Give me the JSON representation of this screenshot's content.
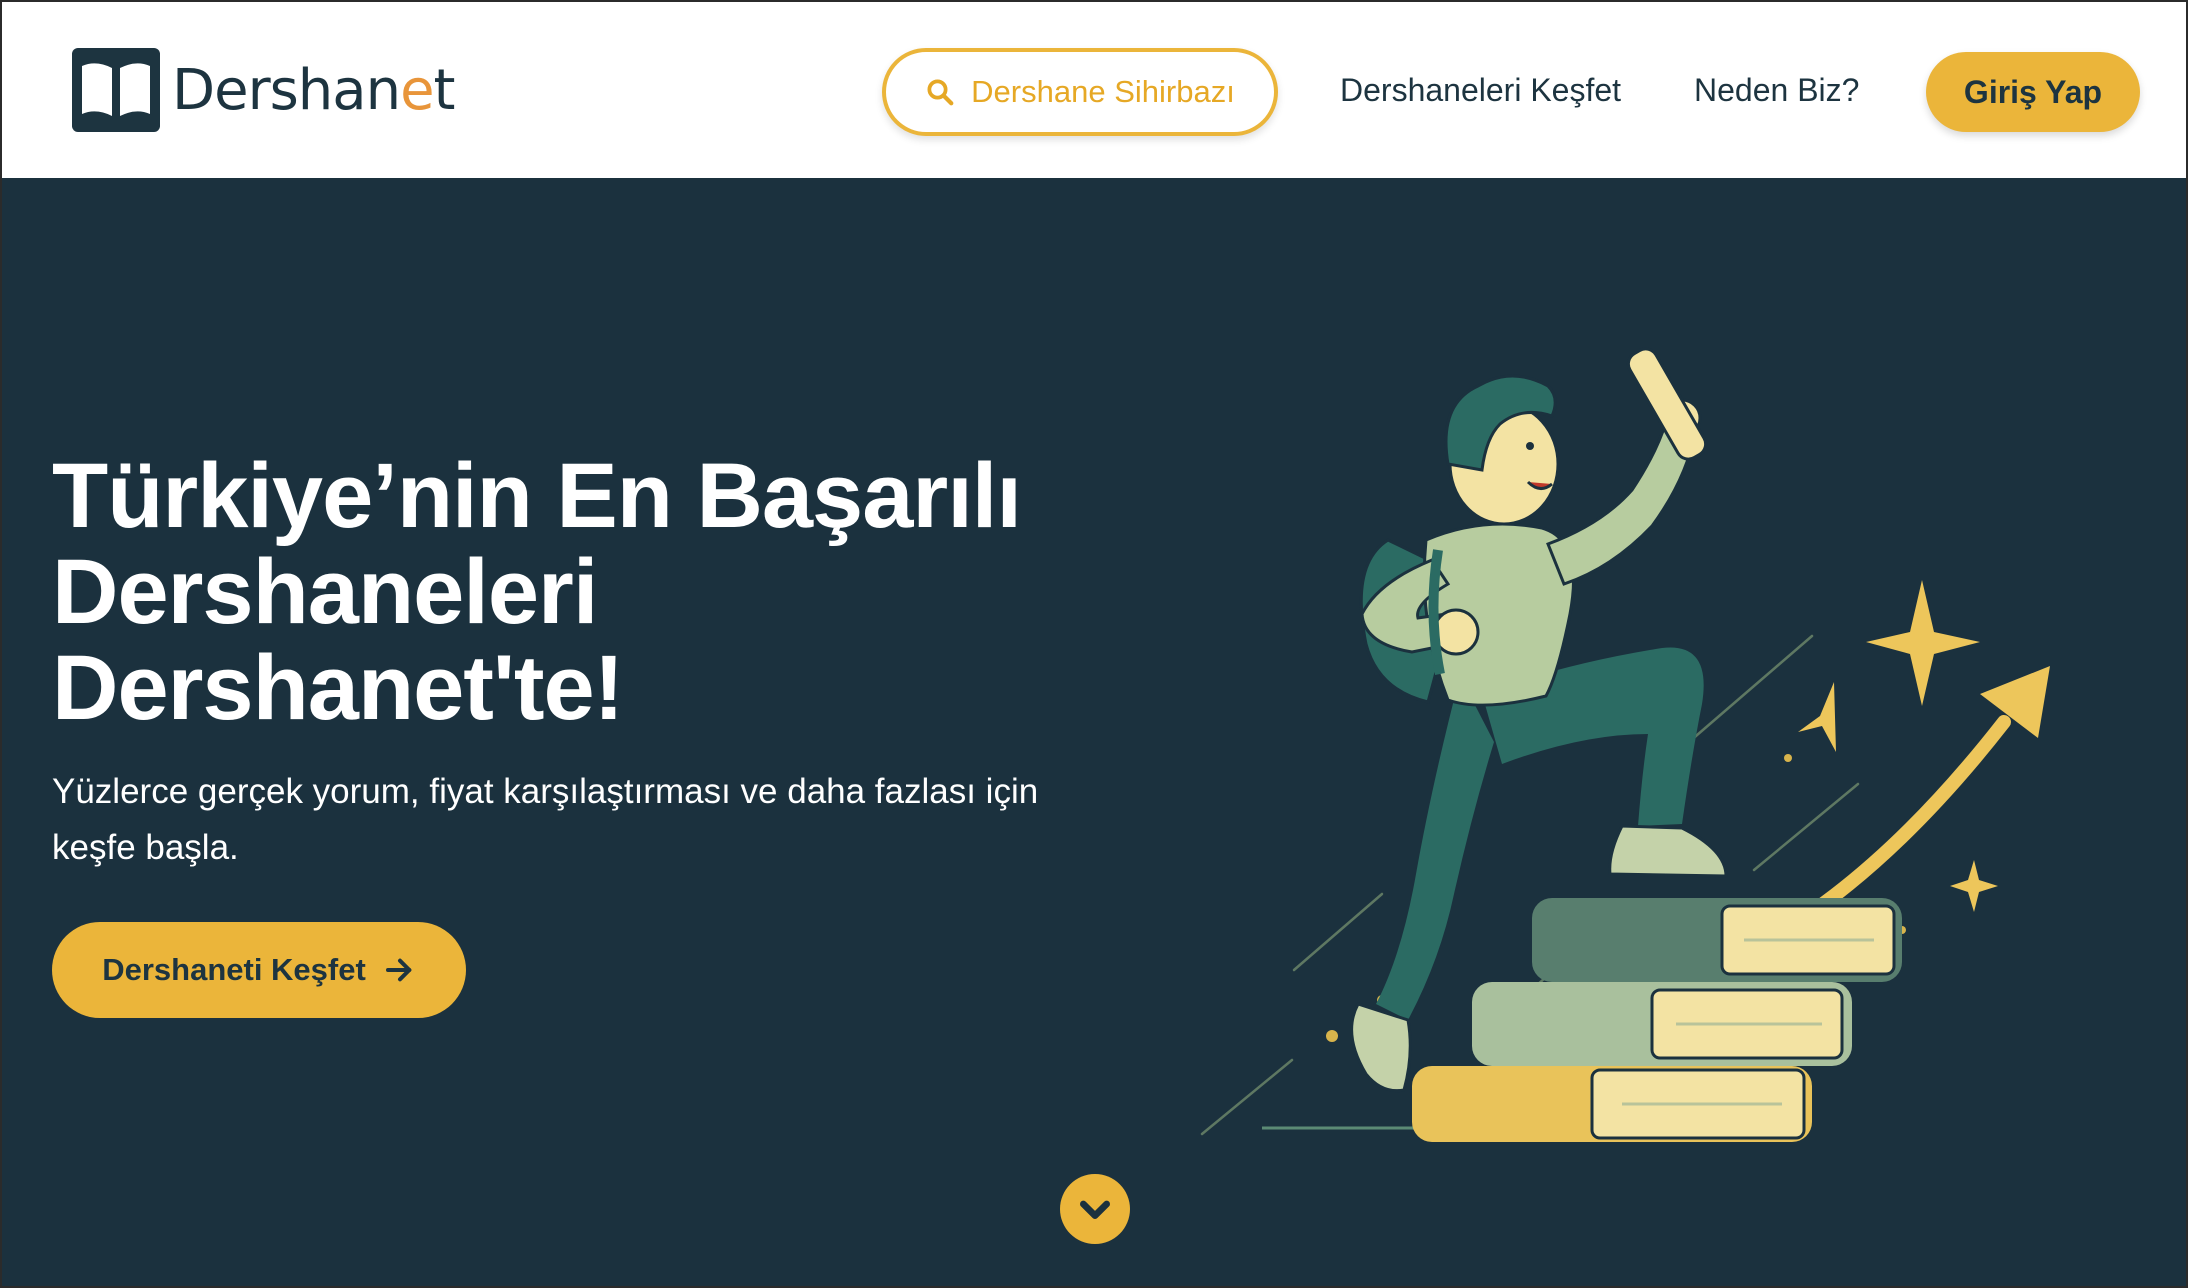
{
  "header": {
    "logo": {
      "text_main": "Dershan",
      "text_accent": "e",
      "text_end": "t",
      "icon": "open-book-logo-icon"
    },
    "wizard_button": {
      "label": "Dershane Sihirbazı",
      "icon": "search-icon"
    },
    "nav": [
      {
        "label": "Dershaneleri Keşfet"
      },
      {
        "label": "Neden Biz?"
      }
    ],
    "login_button": {
      "label": "Giriş Yap"
    }
  },
  "hero": {
    "title_lines": [
      "Türkiye’nin En Başarılı",
      "Dershaneleri",
      "Dershanet'te!"
    ],
    "subtitle": "Yüzlerce gerçek yorum, fiyat karşılaştırması ve daha fazlası için keşfe başla.",
    "cta": {
      "label": "Dershaneti Keşfet",
      "icon": "arrow-right-icon"
    },
    "illustration": {
      "subject": "student-climbing-books-illustration"
    },
    "scroll_button": {
      "icon": "chevron-down-icon"
    }
  },
  "colors": {
    "brand_dark": "#1b313e",
    "brand_yellow": "#ebb53a",
    "brand_orange": "#e8953a",
    "text_dark": "#1d3440"
  }
}
